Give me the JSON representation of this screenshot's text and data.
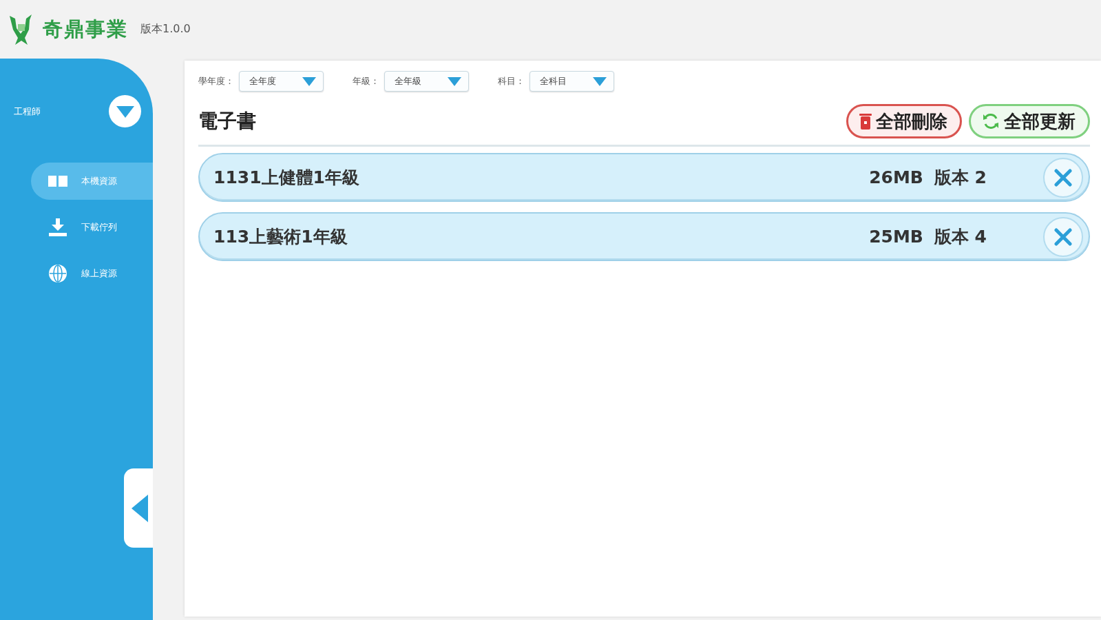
{
  "header": {
    "brand": "奇鼎事業",
    "version": "版本1.0.0"
  },
  "sidebar": {
    "user": "工程師",
    "items": [
      {
        "kind": "book",
        "label": "本機資源",
        "selected": true
      },
      {
        "kind": "download",
        "label": "下載佇列",
        "selected": false
      },
      {
        "kind": "globe",
        "label": "線上資源",
        "selected": false
      }
    ]
  },
  "filters": [
    {
      "label": "學年度：",
      "value": "全年度"
    },
    {
      "label": "年級：",
      "value": "全年級"
    },
    {
      "label": "科目：",
      "value": "全科目"
    }
  ],
  "section": {
    "title": "電子書",
    "buttons": [
      {
        "kind": "delete",
        "label": "全部刪除"
      },
      {
        "kind": "update",
        "label": "全部更新"
      }
    ]
  },
  "books": [
    {
      "title": "1131上健體1年級",
      "size": "26MB",
      "version": "版本 2"
    },
    {
      "title": "113上藝術1年級",
      "size": "25MB",
      "version": "版本 4"
    }
  ]
}
